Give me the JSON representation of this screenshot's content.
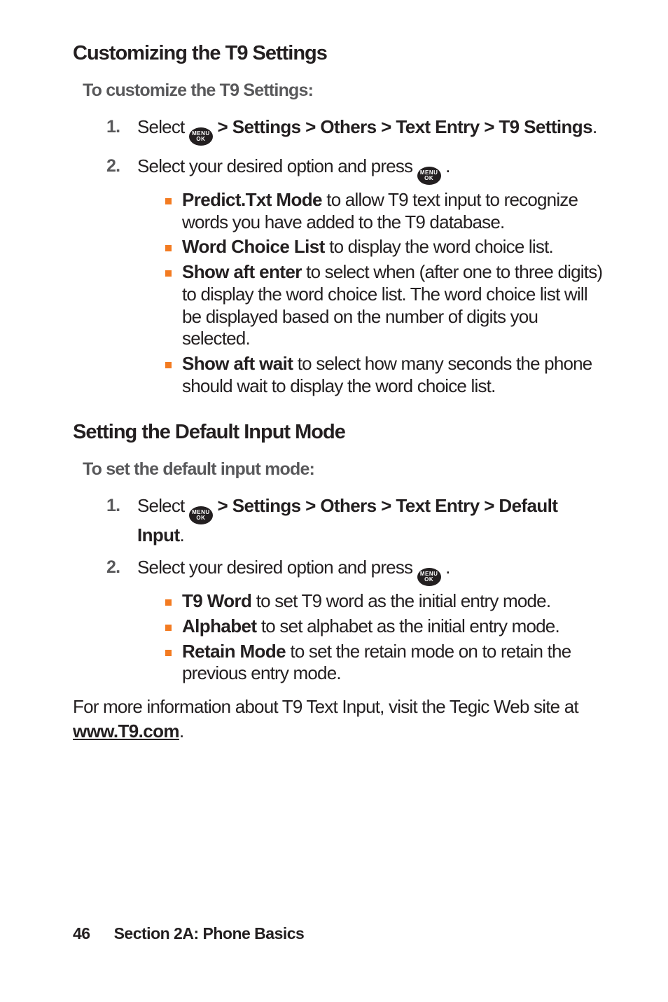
{
  "section1": {
    "heading": "Customizing the T9 Settings",
    "subheading": "To customize the T9 Settings:",
    "step1_pre": "Select ",
    "step1_post": " > Settings > Others > Text Entry > T9 Settings",
    "step2": "Select your desired option and press ",
    "options": {
      "predict": {
        "label": "Predict.Txt Mode",
        "desc": " to allow T9 text input to recognize words you have added to the T9 database."
      },
      "wordchoice": {
        "label": "Word Choice List",
        "desc": " to display the word choice list."
      },
      "aftenter": {
        "label": "Show aft enter",
        "desc": " to select when (after one to three digits) to display the word choice list. The word choice list will be displayed based on the number of digits you selected."
      },
      "aftwait": {
        "label": "Show aft wait",
        "desc": " to select how many seconds the phone should wait to display the word choice list."
      }
    }
  },
  "section2": {
    "heading": "Setting the Default Input Mode",
    "subheading": "To set the default input mode:",
    "step1_pre": "Select ",
    "step1_post": " > Settings > Others > Text Entry > Default Input",
    "step2": "Select your desired option and press ",
    "options": {
      "t9word": {
        "label": "T9 Word",
        "desc": " to set T9 word as the initial entry mode."
      },
      "alphabet": {
        "label": "Alphabet",
        "desc": " to set alphabet as the initial entry mode."
      },
      "retain": {
        "label": "Retain Mode",
        "desc": " to set the retain mode on to retain the previous entry mode."
      }
    }
  },
  "para": {
    "pre": "For more information about T9 Text Input, visit the Tegic Web site at ",
    "link": "www.T9.com"
  },
  "footer": {
    "page": "46",
    "section": "Section 2A: Phone Basics"
  },
  "icon": {
    "top": "MENU",
    "bottom": "OK"
  }
}
